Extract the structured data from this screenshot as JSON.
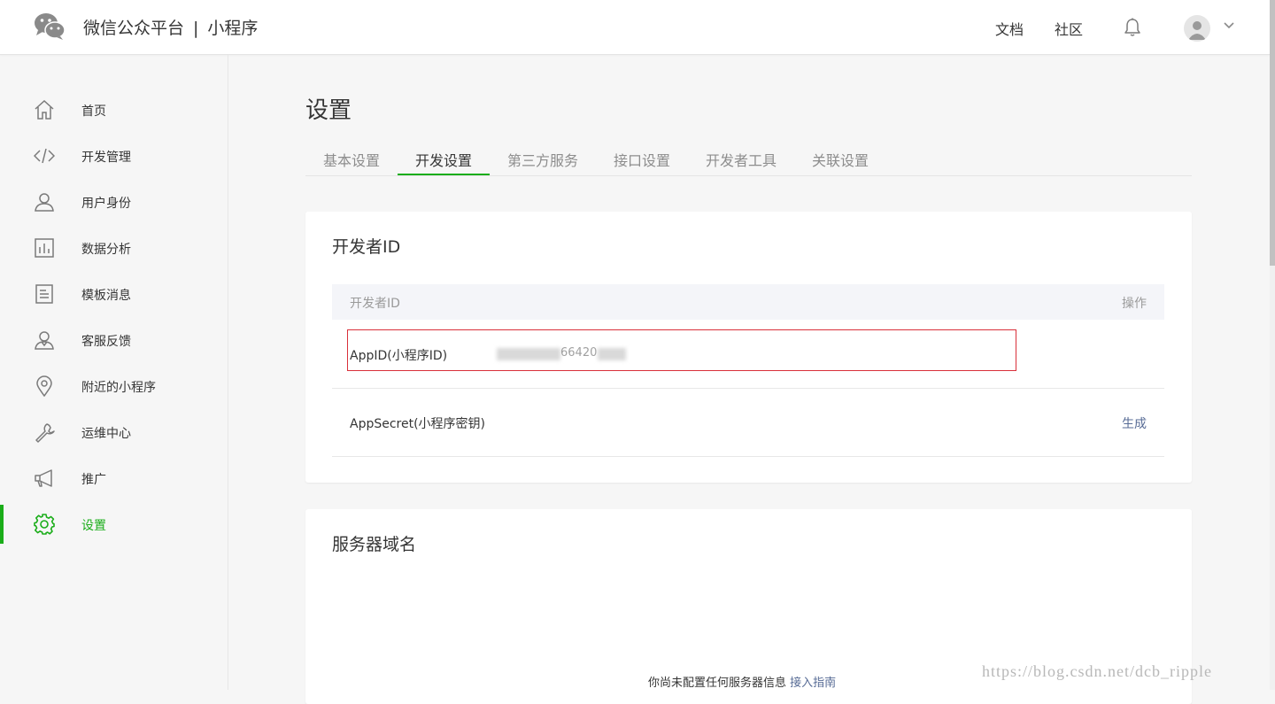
{
  "header": {
    "brand": "微信公众平台",
    "separator": "|",
    "product": "小程序",
    "links": [
      "文档",
      "社区"
    ]
  },
  "sidebar": {
    "items": [
      {
        "label": "首页",
        "icon": "home-icon"
      },
      {
        "label": "开发管理",
        "icon": "code-icon"
      },
      {
        "label": "用户身份",
        "icon": "user-icon"
      },
      {
        "label": "数据分析",
        "icon": "chart-icon"
      },
      {
        "label": "模板消息",
        "icon": "document-icon"
      },
      {
        "label": "客服反馈",
        "icon": "support-icon"
      },
      {
        "label": "附近的小程序",
        "icon": "location-icon"
      },
      {
        "label": "运维中心",
        "icon": "wrench-icon"
      },
      {
        "label": "推广",
        "icon": "megaphone-icon"
      },
      {
        "label": "设置",
        "icon": "gear-icon",
        "active": true
      }
    ]
  },
  "main": {
    "title": "设置",
    "tabs": [
      "基本设置",
      "开发设置",
      "第三方服务",
      "接口设置",
      "开发者工具",
      "关联设置"
    ],
    "active_tab": "开发设置"
  },
  "developer_card": {
    "title": "开发者ID",
    "table_header": {
      "col1": "开发者ID",
      "col2": "操作"
    },
    "rows": [
      {
        "key": "AppID(小程序ID)",
        "value": "66420"
      },
      {
        "key": "AppSecret(小程序密钥)",
        "action": "生成"
      }
    ]
  },
  "server_card": {
    "title": "服务器域名",
    "empty_text": "你尚未配置任何服务器信息",
    "guide_link": "接入指南"
  },
  "watermark": "https://blog.csdn.net/dcb_ripple",
  "colors": {
    "accent_green": "#1aad19",
    "link_blue": "#576b95",
    "highlight_red": "#d9303a",
    "page_bg": "#f6f6f6"
  }
}
